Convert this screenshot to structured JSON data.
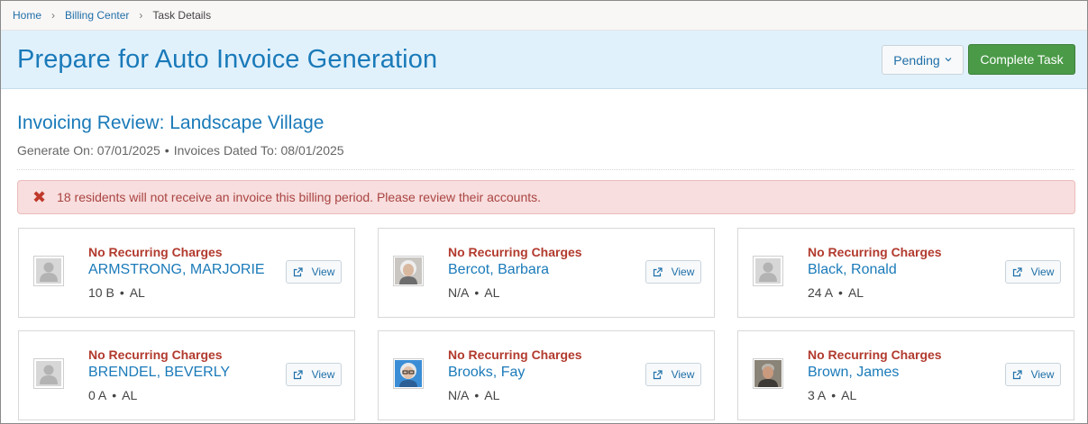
{
  "breadcrumb": {
    "items": [
      "Home",
      "Billing Center"
    ],
    "current": "Task Details"
  },
  "header": {
    "title": "Prepare for Auto Invoice Generation",
    "status_label": "Pending",
    "complete_label": "Complete Task"
  },
  "review": {
    "title": "Invoicing Review: Landscape Village",
    "generate_on": "Generate On: 07/01/2025",
    "dated_to": "Invoices Dated To: 08/01/2025"
  },
  "alert": {
    "message": "18 residents will not receive an invoice this billing period. Please review their accounts."
  },
  "view_label": "View",
  "residents": [
    {
      "tag": "No Recurring Charges",
      "name": "ARMSTRONG, MARJORIE",
      "room": "10 B",
      "care": "AL",
      "avatar": "placeholder-avatar"
    },
    {
      "tag": "No Recurring Charges",
      "name": "Bercot, Barbara",
      "room": "N/A",
      "care": "AL",
      "avatar": "photo-avatar"
    },
    {
      "tag": "No Recurring Charges",
      "name": "Black, Ronald",
      "room": "24 A",
      "care": "AL",
      "avatar": "placeholder-avatar"
    },
    {
      "tag": "No Recurring Charges",
      "name": "BRENDEL, BEVERLY",
      "room": "0 A",
      "care": "AL",
      "avatar": "placeholder-avatar"
    },
    {
      "tag": "No Recurring Charges",
      "name": "Brooks, Fay",
      "room": "N/A",
      "care": "AL",
      "avatar": "photo-avatar"
    },
    {
      "tag": "No Recurring Charges",
      "name": "Brown, James",
      "room": "3 A",
      "care": "AL",
      "avatar": "photo-avatar"
    }
  ],
  "colors": {
    "accent": "#1a7ab9",
    "success": "#4a9a47",
    "danger": "#b23a2e",
    "alert_bg": "#f8dede",
    "header_bg": "#e1f1fc"
  }
}
